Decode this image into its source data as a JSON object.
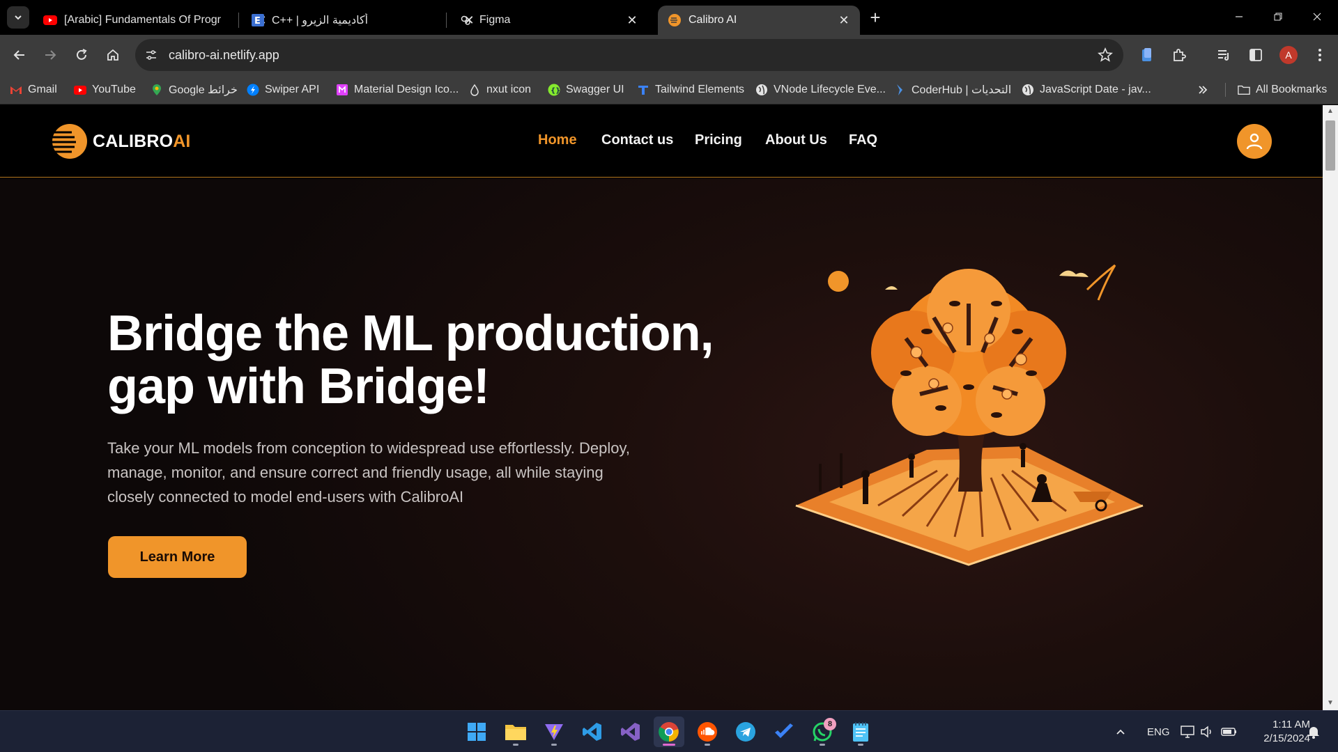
{
  "browser": {
    "tabs": [
      {
        "title": "[Arabic] Fundamentals Of Progr",
        "favicon": "youtube-icon",
        "active": false
      },
      {
        "title": "C++ | أكاديمية الزيرو",
        "favicon": "e-letter-icon",
        "active": false
      },
      {
        "title": "Figma",
        "favicon": "figma-icon",
        "active": false
      },
      {
        "title": "Calibro AI",
        "favicon": "calibro-icon",
        "active": true
      }
    ],
    "url": "calibro-ai.netlify.app",
    "profile_initial": "A",
    "bookmarks": [
      {
        "label": "Gmail",
        "icon": "gmail-icon"
      },
      {
        "label": "YouTube",
        "icon": "youtube-icon"
      },
      {
        "label": "Google خرائط",
        "icon": "maps-pin-icon"
      },
      {
        "label": "Swiper API",
        "icon": "swiper-icon"
      },
      {
        "label": "Material Design Ico...",
        "icon": "material-icon"
      },
      {
        "label": "nxut icon",
        "icon": "drop-icon"
      },
      {
        "label": "Swagger UI",
        "icon": "swagger-icon"
      },
      {
        "label": "Tailwind Elements",
        "icon": "tailwind-icon"
      },
      {
        "label": "VNode Lifecycle Eve...",
        "icon": "globe-icon"
      },
      {
        "label": "CoderHub | التحديات",
        "icon": "coderhub-icon"
      },
      {
        "label": "JavaScript Date - jav...",
        "icon": "globe-icon"
      }
    ],
    "all_bookmarks": "All Bookmarks"
  },
  "site": {
    "logo_main": "CALIBRO",
    "logo_accent": "AI",
    "nav": [
      {
        "label": "Home",
        "active": true
      },
      {
        "label": "Contact us",
        "active": false
      },
      {
        "label": "Pricing",
        "active": false
      },
      {
        "label": "About Us",
        "active": false
      },
      {
        "label": "FAQ",
        "active": false
      }
    ],
    "hero": {
      "title_line1": "Bridge the ML production,",
      "title_line2": "gap with Bridge!",
      "body": "Take your ML models from conception to widespread use effortlessly. Deploy, manage, monitor, and ensure correct and friendly usage, all while staying closely connected to model end-users with CalibroAI",
      "cta": "Learn More"
    },
    "colors": {
      "accent": "#f0952a",
      "background": "#000000"
    }
  },
  "taskbar": {
    "apps": [
      "windows-start-icon",
      "file-explorer-icon",
      "vite-icon",
      "vscode-icon",
      "visual-studio-icon",
      "chrome-icon",
      "soundcloud-icon",
      "telegram-icon",
      "todo-icon",
      "whatsapp-icon",
      "notepad-icon"
    ],
    "whatsapp_badge": "8",
    "language": "ENG",
    "time": "1:11 AM",
    "date": "2/15/2024"
  }
}
